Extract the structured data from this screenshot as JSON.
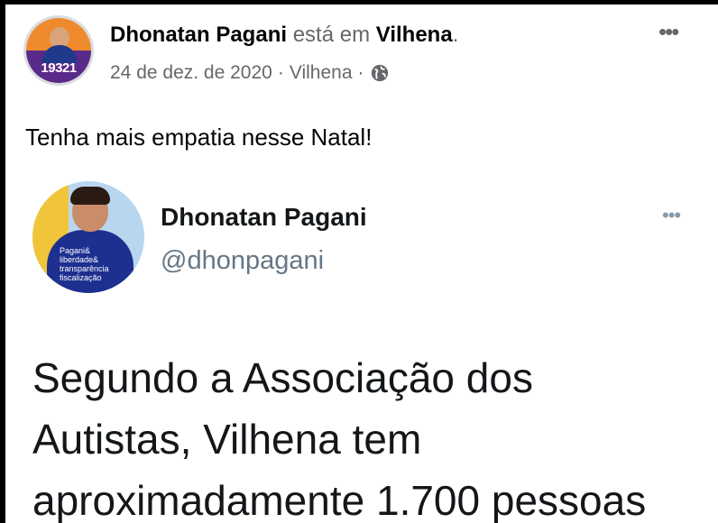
{
  "post": {
    "author": "Dhonatan Pagani",
    "action_text": "está em",
    "place": "Vilhena",
    "period": ".",
    "date": "24 de dez. de 2020",
    "separator": "·",
    "location": "Vilhena",
    "privacy_icon": "globe-icon",
    "more_icon": "more-options-icon",
    "more_glyph": "•••",
    "avatar_number": "19321",
    "text": "Tenha mais empatia nesse Natal!"
  },
  "tweet": {
    "name": "Dhonatan Pagani",
    "handle": "@dhonpagani",
    "more_glyph": "•••",
    "avatar_shirt_text": "Pagani&\nliberdade&\ntransparência\nfiscalização",
    "lines": [
      "Segundo a Associação dos",
      "Autistas, Vilhena tem",
      "aproximadamente 1.700 pessoas"
    ]
  },
  "colors": {
    "text_primary": "#050505",
    "text_secondary": "#65676b",
    "twitter_handle": "#657786"
  }
}
